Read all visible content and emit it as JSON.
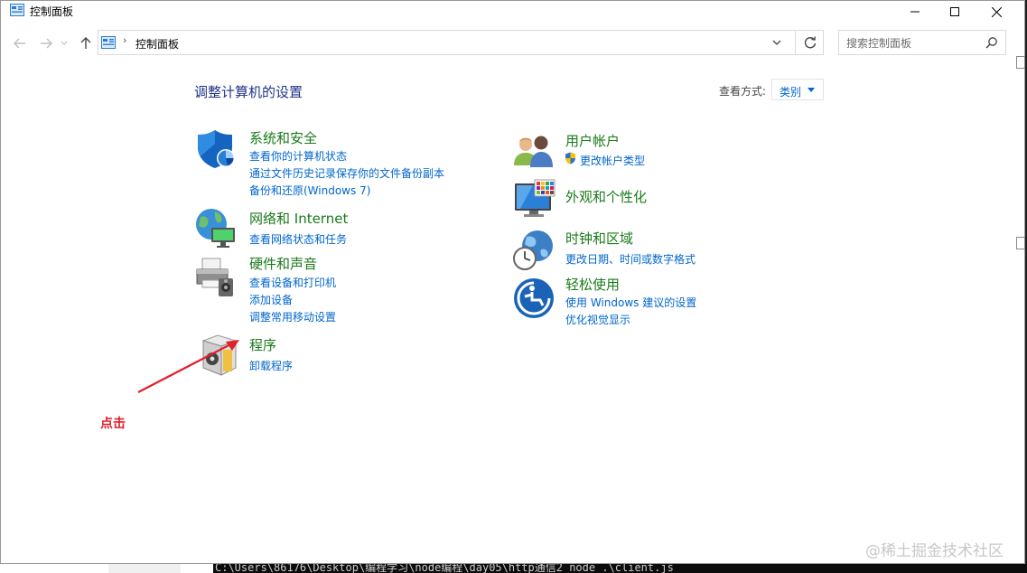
{
  "window": {
    "title": "控制面板"
  },
  "nav": {
    "breadcrumb": "控制面板",
    "search_placeholder": "搜索控制面板"
  },
  "main": {
    "heading": "调整计算机的设置",
    "view_by_label": "查看方式:",
    "view_by_value": "类别"
  },
  "categories": {
    "security": {
      "title": "系统和安全",
      "links": [
        "查看你的计算机状态",
        "通过文件历史记录保存你的文件备份副本",
        "备份和还原(Windows 7)"
      ]
    },
    "network": {
      "title": "网络和 Internet",
      "links": [
        "查看网络状态和任务"
      ]
    },
    "hardware": {
      "title": "硬件和声音",
      "links": [
        "查看设备和打印机",
        "添加设备",
        "调整常用移动设置"
      ]
    },
    "programs": {
      "title": "程序",
      "links": [
        "卸载程序"
      ]
    },
    "users": {
      "title": "用户帐户",
      "links": [
        "更改帐户类型"
      ]
    },
    "appearance": {
      "title": "外观和个性化",
      "links": []
    },
    "clock": {
      "title": "时钟和区域",
      "links": [
        "更改日期、时间或数字格式"
      ]
    },
    "ease": {
      "title": "轻松使用",
      "links": [
        "使用 Windows 建议的设置",
        "优化视觉显示"
      ]
    }
  },
  "annotation": {
    "text": "点击",
    "color": "#e0202a"
  },
  "watermark": "@稀土掘金技术社区",
  "terminal_text": "C:\\Users\\86176\\Desktop\\编程学习\\node编程\\day05\\http通信2 node .\\client.js",
  "colors": {
    "category_title": "#1a7a1a",
    "link": "#0066cc",
    "heading": "#1e3287"
  },
  "icons": [
    "control-panel-icon",
    "back-arrow-icon",
    "forward-arrow-icon",
    "up-arrow-icon",
    "refresh-icon",
    "search-icon",
    "shield-icon",
    "globe-network-icon",
    "printer-icon",
    "programs-box-icon",
    "users-icon",
    "uac-shield-icon",
    "monitor-palette-icon",
    "clock-globe-icon",
    "ease-of-access-icon"
  ]
}
